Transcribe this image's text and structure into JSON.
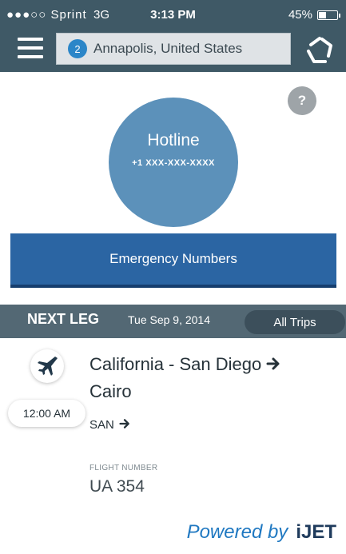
{
  "status_bar": {
    "carrier": "●●●○○ Sprint",
    "network": "3G",
    "time": "3:13 PM",
    "battery": "45%",
    "battery_level": 0.45
  },
  "header": {
    "location_count": "2",
    "location": "Annapolis, United States",
    "icons": [
      "menu-icon",
      "app-logo-icon"
    ]
  },
  "help": {
    "label": "?"
  },
  "hotline": {
    "title": "Hotline",
    "number": "+1 XXX-XXX-XXXX"
  },
  "emergency": {
    "label": "Emergency Numbers"
  },
  "next_leg": {
    "label": "NEXT LEG",
    "date": "Tue Sep 9, 2014",
    "all_trips": "All Trips"
  },
  "flight": {
    "time": "12:00 AM",
    "route_line1": "California - San Diego",
    "route_line2": "Cairo",
    "origin_code": "SAN",
    "flight_number_label": "FLIGHT NUMBER",
    "flight_number": "UA 354"
  },
  "footer": {
    "powered_by": "Powered by",
    "brand": "iJET"
  },
  "colors": {
    "header_bg": "#3f5966",
    "hotline_circle": "#5c91ba",
    "emergency_bar": "#2b65a3",
    "next_leg_bar": "#536874",
    "powered_blue": "#1f78c1"
  }
}
